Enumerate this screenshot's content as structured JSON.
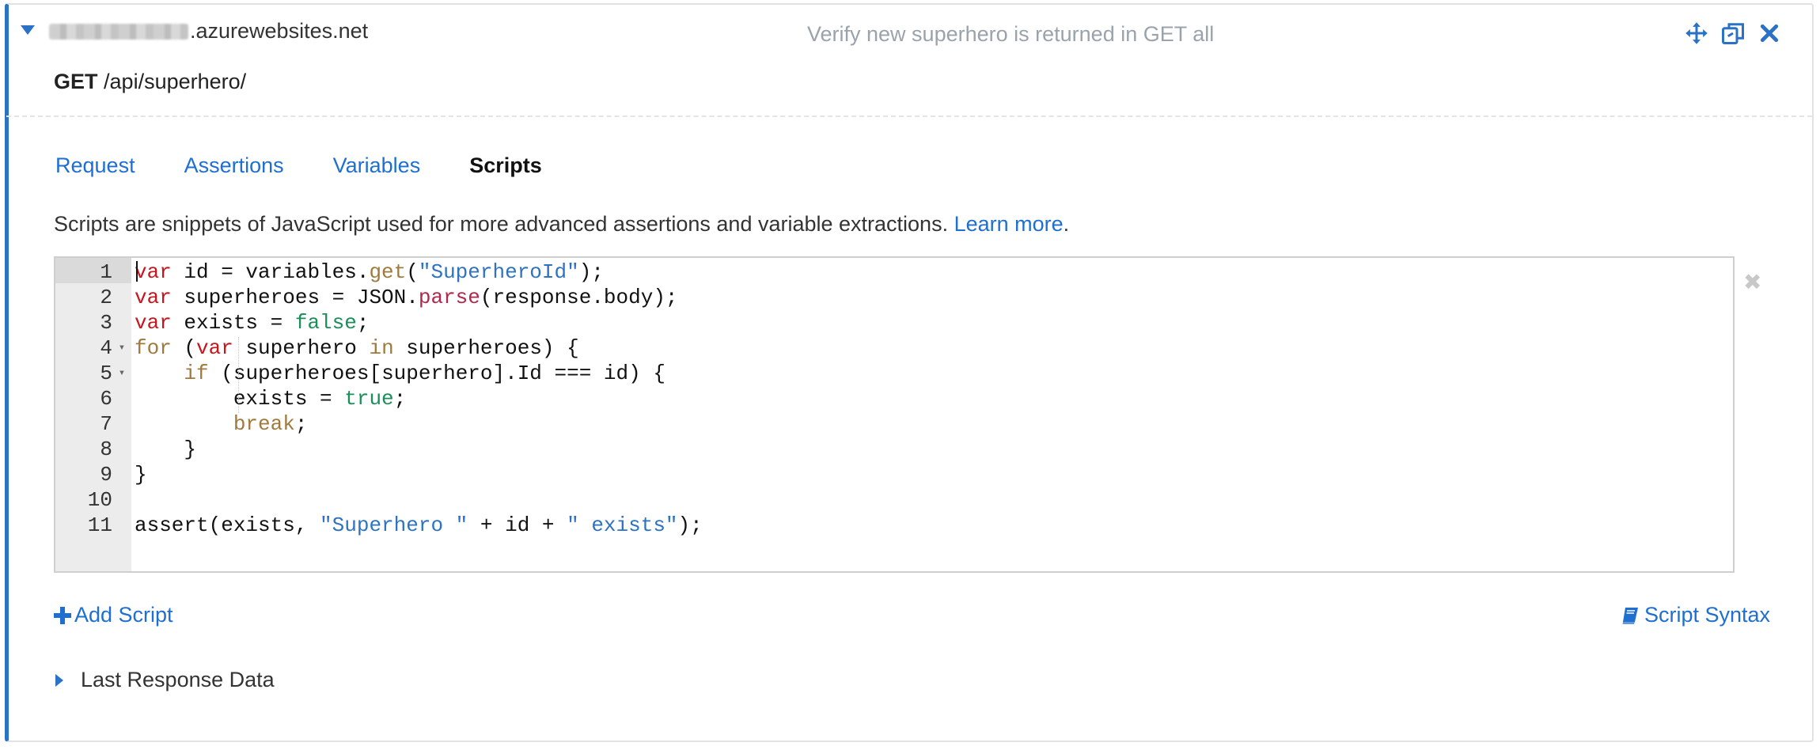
{
  "header": {
    "host_suffix": ".azurewebsites.net",
    "test_title": "Verify new superhero is returned in GET all"
  },
  "request": {
    "method": "GET",
    "path": "/api/superhero/"
  },
  "tabs": [
    {
      "label": "Request",
      "active": false
    },
    {
      "label": "Assertions",
      "active": false
    },
    {
      "label": "Variables",
      "active": false
    },
    {
      "label": "Scripts",
      "active": true
    }
  ],
  "description": {
    "text": "Scripts are snippets of JavaScript used for more advanced assertions and variable extractions.",
    "link": "Learn more",
    "suffix": "."
  },
  "editor": {
    "lines": [
      {
        "n": "1",
        "fold": false,
        "tokens": [
          {
            "t": "var",
            "c": "kw"
          },
          {
            "t": " id = variables."
          },
          {
            "t": "get",
            "c": "fn"
          },
          {
            "t": "("
          },
          {
            "t": "\"SuperheroId\"",
            "c": "str"
          },
          {
            "t": ");"
          }
        ]
      },
      {
        "n": "2",
        "fold": false,
        "tokens": [
          {
            "t": "var",
            "c": "kw"
          },
          {
            "t": " superheroes = JSON."
          },
          {
            "t": "parse",
            "c": "m"
          },
          {
            "t": "(response.body);"
          }
        ]
      },
      {
        "n": "3",
        "fold": false,
        "tokens": [
          {
            "t": "var",
            "c": "kw"
          },
          {
            "t": " exists = "
          },
          {
            "t": "false",
            "c": "bool"
          },
          {
            "t": ";"
          }
        ]
      },
      {
        "n": "4",
        "fold": true,
        "tokens": [
          {
            "t": "for",
            "c": "ctrl"
          },
          {
            "t": " ("
          },
          {
            "t": "var",
            "c": "kw"
          },
          {
            "t": " superhero "
          },
          {
            "t": "in",
            "c": "ctrl"
          },
          {
            "t": " superheroes) {"
          }
        ]
      },
      {
        "n": "5",
        "fold": true,
        "tokens": [
          {
            "t": "    "
          },
          {
            "t": "if",
            "c": "ctrl"
          },
          {
            "t": " (superheroes[superhero].Id === id) {"
          }
        ]
      },
      {
        "n": "6",
        "fold": false,
        "tokens": [
          {
            "t": "        exists = "
          },
          {
            "t": "true",
            "c": "bool"
          },
          {
            "t": ";"
          }
        ]
      },
      {
        "n": "7",
        "fold": false,
        "tokens": [
          {
            "t": "        "
          },
          {
            "t": "break",
            "c": "ctrl"
          },
          {
            "t": ";"
          }
        ]
      },
      {
        "n": "8",
        "fold": false,
        "tokens": [
          {
            "t": "    }"
          }
        ]
      },
      {
        "n": "9",
        "fold": false,
        "tokens": [
          {
            "t": "}"
          }
        ]
      },
      {
        "n": "10",
        "fold": false,
        "tokens": []
      },
      {
        "n": "11",
        "fold": false,
        "tokens": [
          {
            "t": "assert(exists, "
          },
          {
            "t": "\"Superhero \"",
            "c": "str"
          },
          {
            "t": " + id + "
          },
          {
            "t": "\" exists\"",
            "c": "str"
          },
          {
            "t": ");"
          }
        ]
      }
    ]
  },
  "actions": {
    "add_script": "Add Script",
    "script_syntax": "Script Syntax",
    "last_response": "Last Response Data"
  },
  "icons": {
    "move": "move-icon",
    "duplicate": "duplicate-icon",
    "close": "close-icon",
    "remove_script": "remove-script-icon",
    "plus": "plus-icon",
    "book": "book-icon"
  },
  "colors": {
    "accent": "#2a72c6",
    "link": "#1e6fd0"
  }
}
